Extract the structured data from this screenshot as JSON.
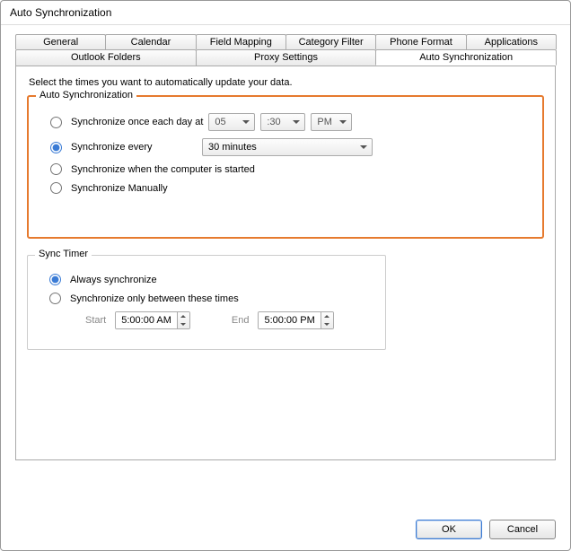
{
  "window": {
    "title": "Auto Synchronization"
  },
  "tabs": {
    "row1": [
      "General",
      "Calendar",
      "Field Mapping",
      "Category Filter",
      "Phone Format",
      "Applications"
    ],
    "row2": [
      "Outlook Folders",
      "Proxy Settings",
      "Auto Synchronization"
    ],
    "active": "Auto Synchronization"
  },
  "instruction": "Select the times you want to automatically update your data.",
  "autoSync": {
    "legend": "Auto Synchronization",
    "opt_once": "Synchronize once each day at",
    "once_hour": "05",
    "once_min": ":30",
    "once_ampm": "PM",
    "opt_every": "Synchronize every",
    "every_value": "30 minutes",
    "opt_start": "Synchronize when the computer is started",
    "opt_manual": "Synchronize Manually",
    "selected": "every"
  },
  "syncTimer": {
    "legend": "Sync Timer",
    "opt_always": "Always synchronize",
    "opt_between": "Synchronize only between these times",
    "selected": "always",
    "start_label": "Start",
    "start_value": "5:00:00 AM",
    "end_label": "End",
    "end_value": "5:00:00 PM"
  },
  "buttons": {
    "ok": "OK",
    "cancel": "Cancel"
  }
}
